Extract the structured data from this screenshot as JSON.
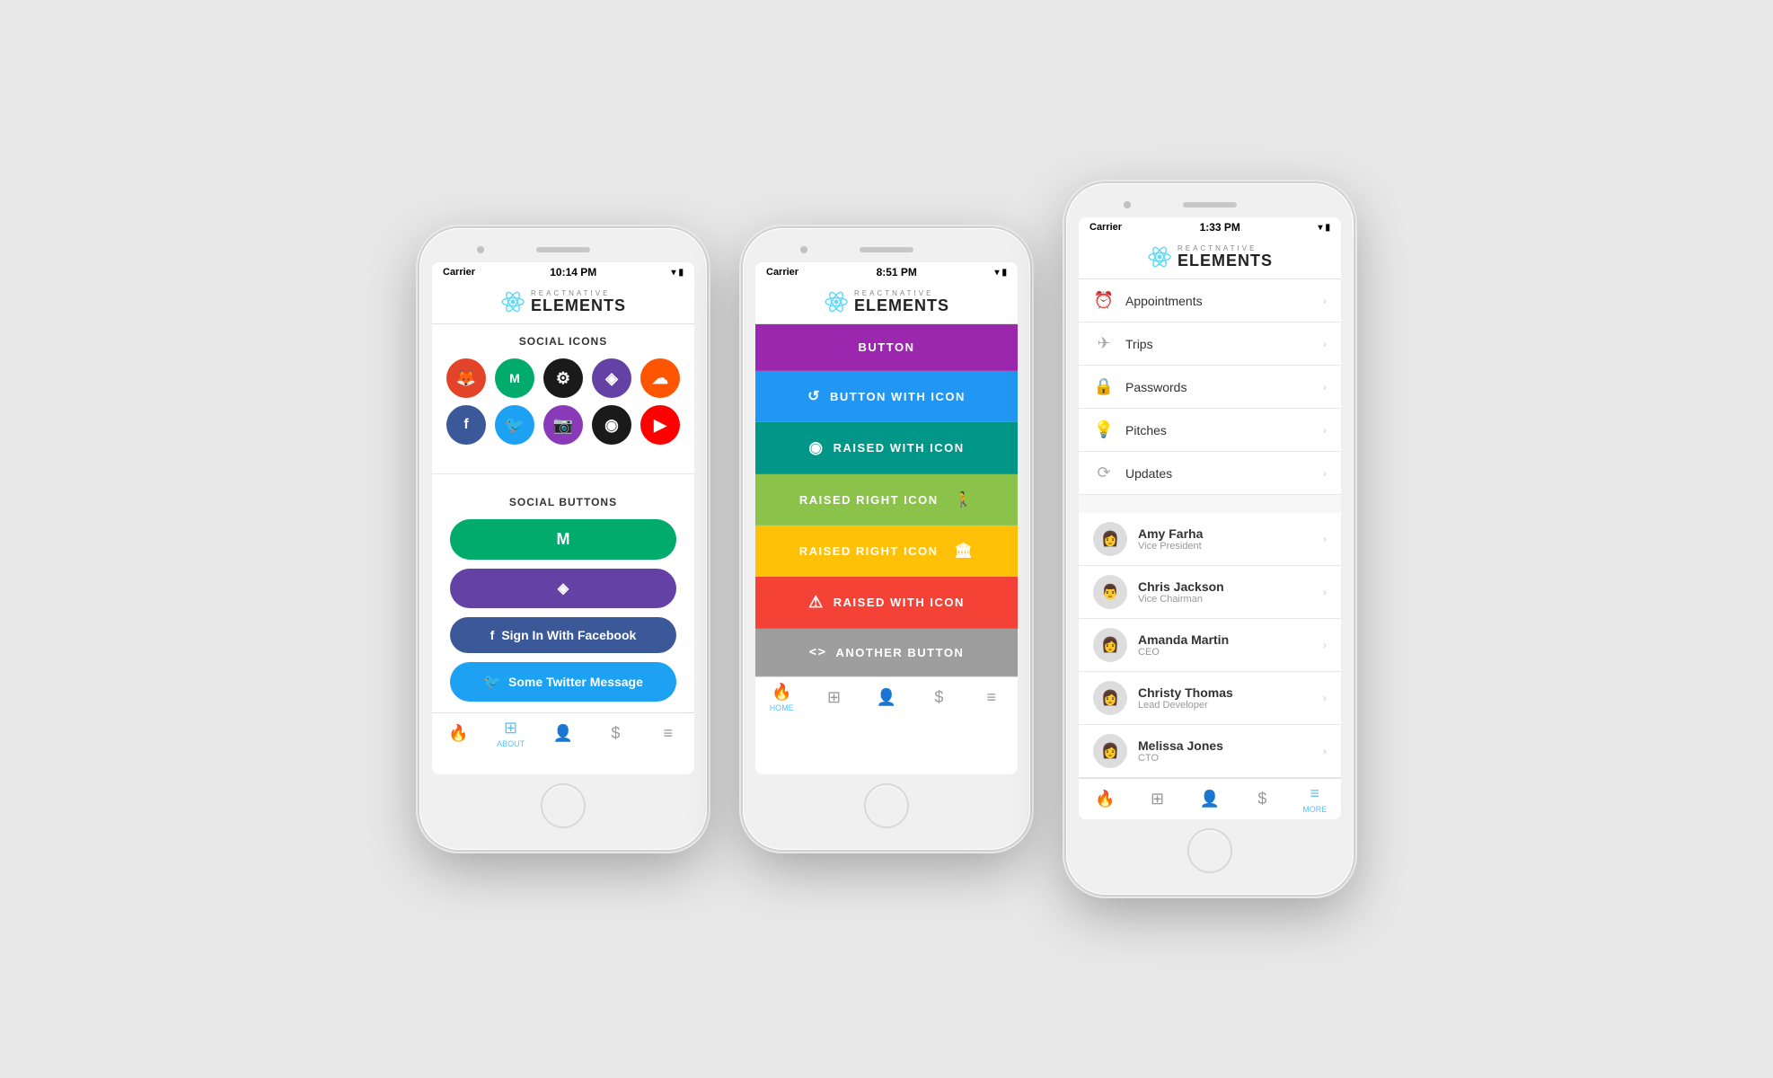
{
  "page": {
    "background": "#e8e8e8"
  },
  "app": {
    "logo_top": "REACTNATIVE",
    "logo_bottom": "ELEMENTS"
  },
  "phone1": {
    "status": {
      "carrier": "Carrier",
      "time": "10:14 PM",
      "battery": "▮▮▮▮"
    },
    "section1_title": "SOCIAL ICONS",
    "social_icons": [
      {
        "name": "gitlab",
        "color": "#e24329",
        "symbol": "🦊"
      },
      {
        "name": "medium",
        "color": "#00ab6c",
        "symbol": "M"
      },
      {
        "name": "github",
        "color": "#1a1a1a",
        "symbol": "⚙"
      },
      {
        "name": "twitch",
        "color": "#6441a5",
        "symbol": "◈"
      },
      {
        "name": "soundcloud",
        "color": "#ff5500",
        "symbol": "☁"
      }
    ],
    "social_icons2": [
      {
        "name": "facebook",
        "color": "#3b5998",
        "symbol": "f"
      },
      {
        "name": "twitter",
        "color": "#1da1f2",
        "symbol": "🐦"
      },
      {
        "name": "instagram",
        "color": "#8a3ab9",
        "symbol": "📷"
      },
      {
        "name": "codepen",
        "color": "#1a1a1a",
        "symbol": "◉"
      },
      {
        "name": "youtube",
        "color": "#ff0000",
        "symbol": "▶"
      }
    ],
    "section2_title": "SOCIAL BUTTONS",
    "social_buttons": [
      {
        "label": "",
        "icon": "M",
        "color": "#00ab6c"
      },
      {
        "label": "",
        "icon": "◈",
        "color": "#6441a5"
      },
      {
        "label": "Sign In With Facebook",
        "icon": "f",
        "color": "#3b5998"
      },
      {
        "label": "Some Twitter Message",
        "icon": "🐦",
        "color": "#1da1f2"
      }
    ],
    "tab_items": [
      {
        "icon": "🔥",
        "label": "",
        "active": false
      },
      {
        "icon": "⊞",
        "label": "ABOUT",
        "active": true
      },
      {
        "icon": "👤",
        "label": "",
        "active": false
      },
      {
        "icon": "$",
        "label": "",
        "active": false
      },
      {
        "icon": "≡",
        "label": "",
        "active": false
      }
    ]
  },
  "phone2": {
    "status": {
      "carrier": "Carrier",
      "time": "8:51 PM",
      "battery": "▮▮▮▮"
    },
    "buttons": [
      {
        "label": "BUTTON",
        "icon": "",
        "color": "#9b27af"
      },
      {
        "label": "BUTTON WITH ICON",
        "icon": "↺",
        "color": "#2196f3"
      },
      {
        "label": "RAISED WITH ICON",
        "icon": "◉",
        "color": "#009688"
      },
      {
        "label": "RAISED RIGHT ICON",
        "icon": "🚶",
        "color": "#8bc34a"
      },
      {
        "label": "RAISED RIGHT ICON",
        "icon": "🏛",
        "color": "#ffc107"
      },
      {
        "label": "RAISED WITH ICON",
        "icon": "⚠",
        "color": "#f44336"
      },
      {
        "label": "ANOTHER BUTTON",
        "icon": "<>",
        "color": "#9e9e9e"
      }
    ],
    "tab_items": [
      {
        "icon": "🔥",
        "label": "HOME",
        "active": true
      },
      {
        "icon": "⊞",
        "label": "",
        "active": false
      },
      {
        "icon": "👤",
        "label": "",
        "active": false
      },
      {
        "icon": "$",
        "label": "",
        "active": false
      },
      {
        "icon": "≡",
        "label": "",
        "active": false
      }
    ]
  },
  "phone3": {
    "status": {
      "carrier": "Carrier",
      "time": "1:33 PM",
      "battery": "▮▮▮▮"
    },
    "menu_items": [
      {
        "icon": "⏰",
        "label": "Appointments"
      },
      {
        "icon": "✈",
        "label": "Trips"
      },
      {
        "icon": "🔒",
        "label": "Passwords"
      },
      {
        "icon": "💡",
        "label": "Pitches"
      },
      {
        "icon": "⟳",
        "label": "Updates"
      }
    ],
    "contacts": [
      {
        "name": "Amy Farha",
        "title": "Vice President",
        "avatar": "👩"
      },
      {
        "name": "Chris Jackson",
        "title": "Vice Chairman",
        "avatar": "👨"
      },
      {
        "name": "Amanda Martin",
        "title": "CEO",
        "avatar": "👩"
      },
      {
        "name": "Christy Thomas",
        "title": "Lead Developer",
        "avatar": "👩"
      },
      {
        "name": "Melissa Jones",
        "title": "CTO",
        "avatar": "👩"
      }
    ],
    "tab_items": [
      {
        "icon": "🔥",
        "label": "",
        "active": false
      },
      {
        "icon": "⊞",
        "label": "",
        "active": false
      },
      {
        "icon": "👤",
        "label": "",
        "active": false
      },
      {
        "icon": "$",
        "label": "",
        "active": false
      },
      {
        "icon": "≡",
        "label": "MORE",
        "active": true
      }
    ]
  }
}
